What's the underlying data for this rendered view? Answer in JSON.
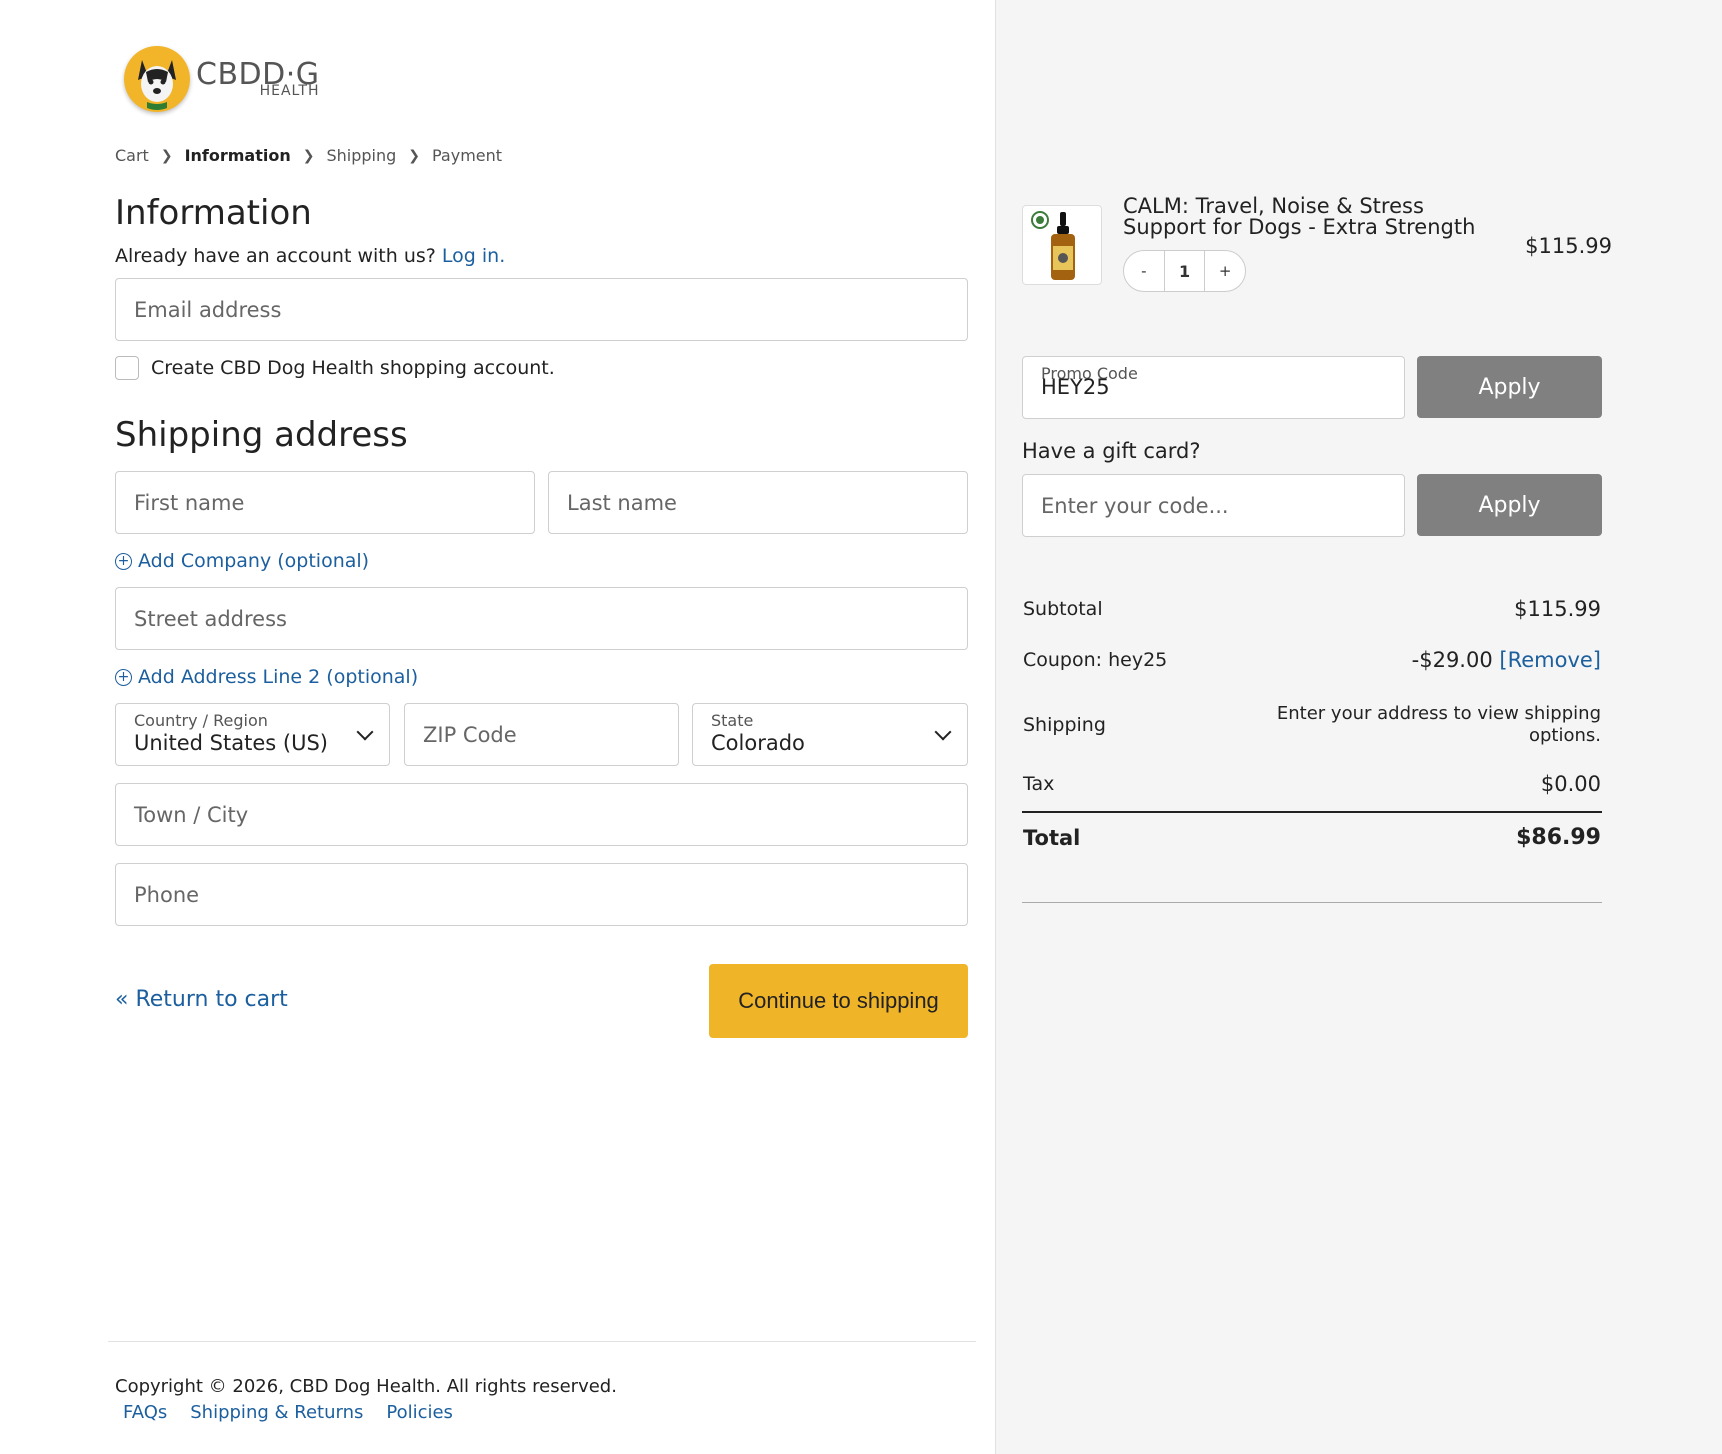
{
  "logo": {
    "main": "CBDD·G",
    "sub": "HEALTH"
  },
  "breadcrumb": [
    "Cart",
    "Information",
    "Shipping",
    "Payment"
  ],
  "information": {
    "heading": "Information",
    "account_prompt": "Already have an account with us?",
    "login_link": "Log in.",
    "email_placeholder": "Email address",
    "create_account_label": "Create CBD Dog Health shopping account."
  },
  "shipping": {
    "heading": "Shipping address",
    "first_name_placeholder": "First name",
    "last_name_placeholder": "Last name",
    "add_company": "Add Company (optional)",
    "street_placeholder": "Street address",
    "add_line2": "Add Address Line 2 (optional)",
    "country_label": "Country / Region",
    "country_value": "United States (US)",
    "zip_placeholder": "ZIP Code",
    "state_label": "State",
    "state_value": "Colorado",
    "city_placeholder": "Town / City",
    "phone_placeholder": "Phone"
  },
  "actions": {
    "return_to_cart": "« Return to cart",
    "continue": "Continue to shipping"
  },
  "footer": {
    "copyright": "Copyright © 2026, CBD Dog Health. All rights reserved.",
    "links": [
      "FAQs",
      "Shipping & Returns",
      "Policies"
    ]
  },
  "cart": {
    "product_title": "CALM: Travel, Noise & Stress Support for Dogs - Extra Strength",
    "product_price": "$115.99",
    "qty_minus": "-",
    "qty_value": "1",
    "qty_plus": "+",
    "promo_label": "Promo Code",
    "promo_value": "HEY25",
    "apply_label": "Apply",
    "gift_question": "Have a gift card?",
    "gift_placeholder": "Enter your code...",
    "gift_apply_label": "Apply"
  },
  "summary": {
    "subtotal_label": "Subtotal",
    "subtotal_value": "$115.99",
    "coupon_label": "Coupon: hey25",
    "coupon_value": "-$29.00",
    "coupon_remove": "[Remove]",
    "shipping_label": "Shipping",
    "shipping_note": "Enter your address to view shipping options.",
    "tax_label": "Tax",
    "tax_value": "$0.00",
    "total_label": "Total",
    "total_value": "$86.99"
  },
  "colors": {
    "accent": "#f0b429",
    "link": "#1c5f9e",
    "apply_button": "#808080"
  }
}
